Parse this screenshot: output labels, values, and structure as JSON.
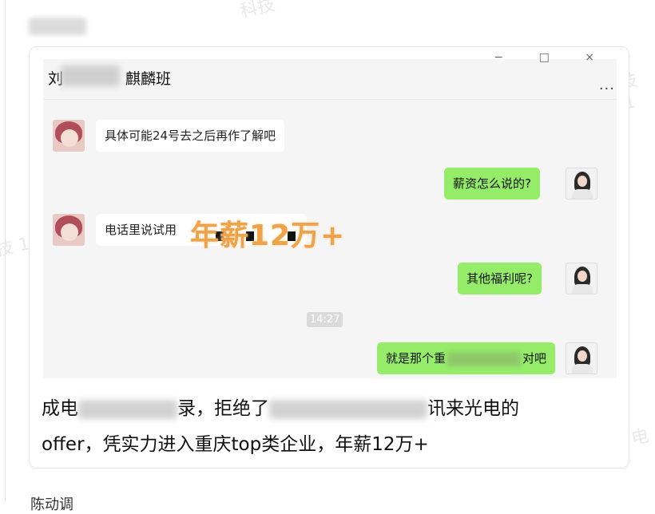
{
  "watermarks": [
    "科技",
    "技 1",
    "技 19",
    "电"
  ],
  "chat": {
    "title_prefix": "刘",
    "title_suffix": "麒麟班",
    "window_controls": "− □ ×",
    "more_label": "...",
    "messages": [
      {
        "side": "left",
        "text": "具体可能24号去之后再作了解吧"
      },
      {
        "side": "right",
        "text": "薪资怎么说的?"
      },
      {
        "side": "left",
        "text": "电话里说试用"
      },
      {
        "side": "right",
        "text": "其他福利呢?"
      },
      {
        "side": "right",
        "text_before": "就是那个重",
        "text_after": "对吧"
      }
    ],
    "timestamp": "14:27",
    "overlay": "年薪12万+"
  },
  "caption": {
    "line1_part1": "成电",
    "line1_part2": "录，拒绝了",
    "line1_part3": "讯来光电的",
    "line2": "offer，凭实力进入重庆top类企业，年薪12万+"
  },
  "footer": {
    "partial_text": "陈动调"
  }
}
